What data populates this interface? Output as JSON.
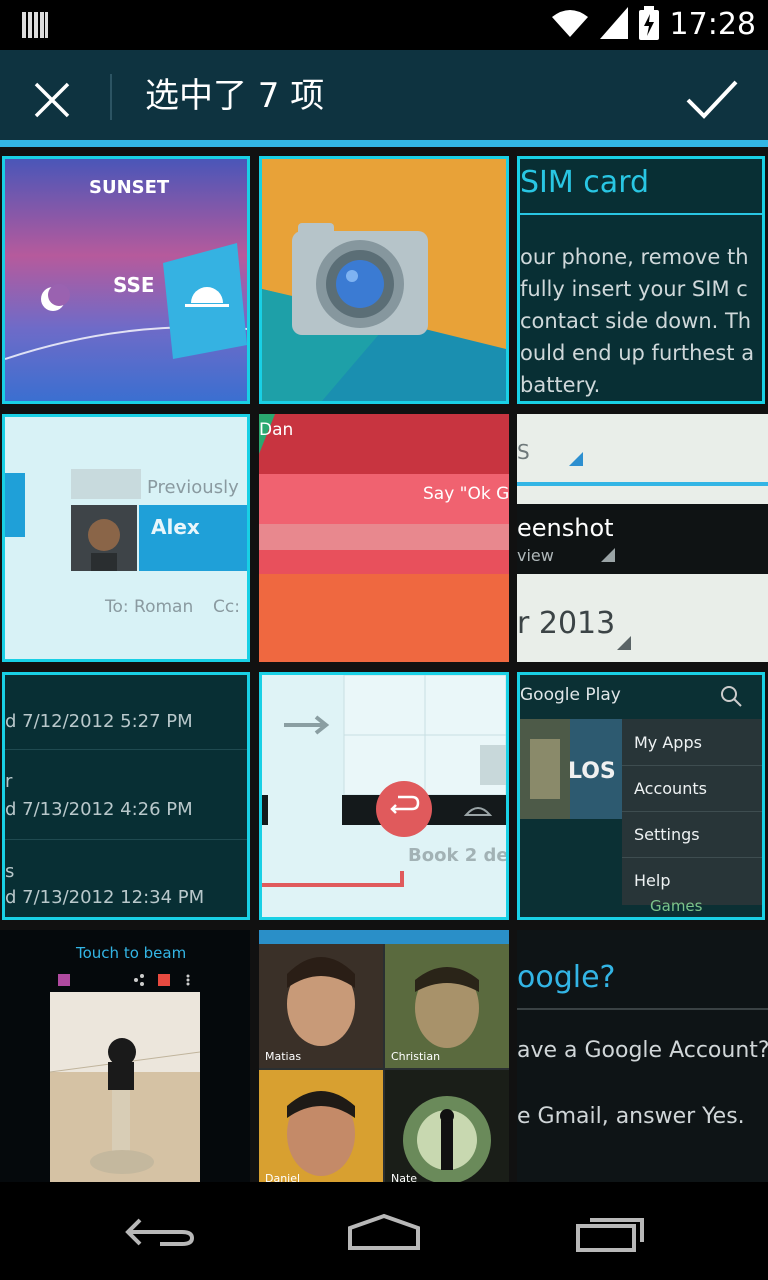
{
  "status_bar": {
    "time": "17:28",
    "icons": [
      "barcode-icon",
      "wifi-icon",
      "signal-icon",
      "battery-charging-icon"
    ]
  },
  "action_bar": {
    "title": "选中了 7 项",
    "close_icon": "close-icon",
    "confirm_icon": "check-icon",
    "accent_color": "#33b5e5",
    "background_color": "#0e3340"
  },
  "selection_color": "#19d0e5",
  "tiles": [
    {
      "id": "sunset-wallpaper",
      "selected": true,
      "texts": [
        "SUNSET",
        "SSE"
      ]
    },
    {
      "id": "camera-app",
      "selected": true,
      "texts": []
    },
    {
      "id": "sim-card-help",
      "selected": true,
      "texts": [
        "SIM card",
        "our phone, remove th",
        "fully insert your SIM c",
        "contact side down. Th",
        "ould end up furthest a",
        "battery."
      ]
    },
    {
      "id": "email-contact",
      "selected": true,
      "texts": [
        "Previously",
        "Alex",
        "To: Roman",
        "Cc:"
      ]
    },
    {
      "id": "now-cards",
      "selected": false,
      "texts": [
        "Dan",
        "Say \"Ok Go"
      ]
    },
    {
      "id": "screenshot-settings",
      "selected": false,
      "texts": [
        "S",
        "eenshot",
        "view",
        "r 2013"
      ]
    },
    {
      "id": "call-log",
      "selected": true,
      "texts": [
        "d 7/12/2012 5:27 PM",
        "r",
        "d 7/13/2012 4:26 PM",
        "s",
        "d 7/13/2012 12:34 PM"
      ]
    },
    {
      "id": "book-reader",
      "selected": true,
      "texts": [
        "Book 2 de"
      ]
    },
    {
      "id": "google-play-menu",
      "selected": true,
      "texts": [
        "Google Play",
        "My Apps",
        "Accounts",
        "Settings",
        "Help",
        "Games",
        "LOS"
      ]
    },
    {
      "id": "android-beam",
      "selected": false,
      "texts": [
        "Touch to beam"
      ]
    },
    {
      "id": "people-contacts",
      "selected": false,
      "texts": [
        "Matias",
        "Christian",
        "Daniel",
        "Nate"
      ]
    },
    {
      "id": "google-account-setup",
      "selected": false,
      "texts": [
        "oogle?",
        "ave a Google Account?",
        "e Gmail, answer Yes."
      ]
    }
  ],
  "nav_bar": {
    "buttons": [
      "back-icon",
      "home-icon",
      "recents-icon"
    ]
  }
}
